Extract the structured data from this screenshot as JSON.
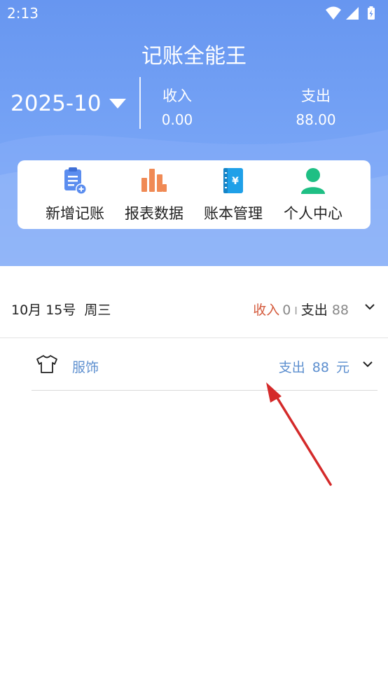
{
  "status_bar": {
    "time": "2:13"
  },
  "app": {
    "title": "记账全能王"
  },
  "summary": {
    "month": "2025-10",
    "income_label": "收入",
    "income_value": "0.00",
    "expense_label": "支出",
    "expense_value": "88.00"
  },
  "menu": [
    {
      "label": "新增记账",
      "icon": "add-record-icon"
    },
    {
      "label": "报表数据",
      "icon": "bar-chart-icon"
    },
    {
      "label": "账本管理",
      "icon": "ledger-book-icon"
    },
    {
      "label": "个人中心",
      "icon": "user-profile-icon"
    }
  ],
  "day_group": {
    "date": "10月 15号",
    "weekday": "周三",
    "income_label": "收入",
    "income_value": "0",
    "separator": "I",
    "expense_label": "支出",
    "expense_value": "88"
  },
  "record": {
    "icon": "clothing-icon",
    "category": "服饰",
    "type_label": "支出",
    "amount": "88",
    "unit": "元"
  },
  "colors": {
    "header_blue": "#6796f0",
    "income_red": "#d45a3c",
    "record_blue": "#5d8fcf",
    "arrow_red": "#d42a2a"
  }
}
